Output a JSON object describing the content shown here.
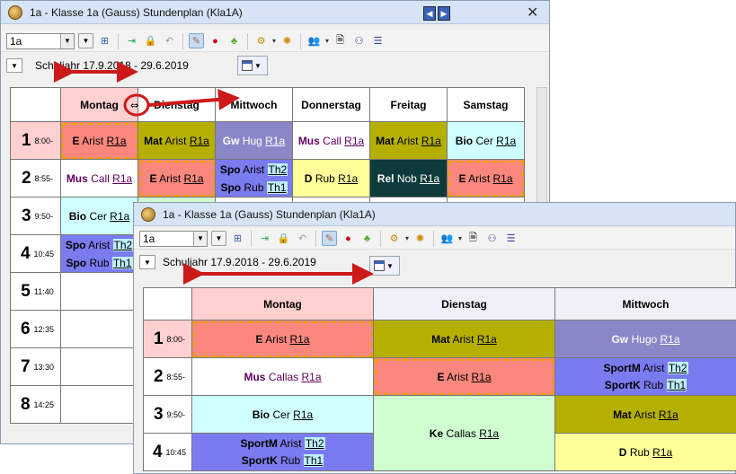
{
  "win1": {
    "title": "1a - Klasse 1a (Gauss)  Stundenplan  (Kla1A)",
    "class_select": "1a",
    "year": "Schuljahr 17.9.2018 - 29.6.2019",
    "days": [
      "Montag",
      "Dienstag",
      "Mittwoch",
      "Donnerstag",
      "Freitag",
      "Samstag"
    ],
    "periods": [
      {
        "num": "1",
        "time": "8:00-"
      },
      {
        "num": "2",
        "time": "8:55-"
      },
      {
        "num": "3",
        "time": "9:50-"
      },
      {
        "num": "4",
        "time": "10:45"
      },
      {
        "num": "5",
        "time": "11:40"
      },
      {
        "num": "6",
        "time": "12:35"
      },
      {
        "num": "7",
        "time": "13:30"
      },
      {
        "num": "8",
        "time": "14:25"
      }
    ],
    "row1": [
      {
        "subj": "E",
        "teacher": "Arist",
        "room": "R1a"
      },
      {
        "subj": "Mat",
        "teacher": "Arist",
        "room": "R1a"
      },
      {
        "subj": "Gw",
        "teacher": "Hug",
        "room": "R1a"
      },
      {
        "subj": "Mus",
        "teacher": "Call",
        "room": "R1a"
      },
      {
        "subj": "Mat",
        "teacher": "Arist",
        "room": "R1a"
      },
      {
        "subj": "Bio",
        "teacher": "Cer",
        "room": "R1a"
      }
    ],
    "row2": [
      {
        "subj": "Mus",
        "teacher": "Call",
        "room": "R1a"
      },
      {
        "subj": "E",
        "teacher": "Arist",
        "room": "R1a"
      },
      {
        "subj": "Spo",
        "teacher": "Arist",
        "room": "Th2",
        "subj2": "Spo",
        "teacher2": "Rub",
        "room2": "Th1"
      },
      {
        "subj": "D",
        "teacher": "Rub",
        "room": "R1a"
      },
      {
        "subj": "Rel",
        "teacher": "Nob",
        "room": "R1a"
      },
      {
        "subj": "E",
        "teacher": "Arist",
        "room": "R1a"
      }
    ],
    "row3_mon": {
      "subj": "Bio",
      "teacher": "Cer",
      "room": "R1a"
    },
    "row4_mon": {
      "subj": "Spo",
      "teacher": "Arist",
      "room": "Th2",
      "subj2": "Spo",
      "teacher2": "Rub",
      "room2": "Th1"
    }
  },
  "win2": {
    "title": "1a - Klasse 1a (Gauss)  Stundenplan  (Kla1A)",
    "class_select": "1a",
    "year": "Schuljahr 17.9.2018 - 29.6.2019",
    "days": [
      "Montag",
      "Dienstag",
      "Mittwoch"
    ],
    "periods": [
      {
        "num": "1",
        "time": "8:00-"
      },
      {
        "num": "2",
        "time": "8:55-"
      },
      {
        "num": "3",
        "time": "9:50-"
      },
      {
        "num": "4",
        "time": "10:45"
      }
    ],
    "cells": {
      "r1": [
        {
          "subj": "E",
          "teacher": "Arist",
          "room": "R1a"
        },
        {
          "subj": "Mat",
          "teacher": "Arist",
          "room": "R1a"
        },
        {
          "subj": "Gw",
          "teacher": "Hugo",
          "room": "R1a"
        }
      ],
      "r2": [
        {
          "subj": "Mus",
          "teacher": "Callas",
          "room": "R1a"
        },
        {
          "subj": "E",
          "teacher": "Arist",
          "room": "R1a"
        },
        {
          "subj": "SportM",
          "teacher": "Arist",
          "room": "Th2",
          "subj2": "SportK",
          "teacher2": "Rub",
          "room2": "Th1"
        }
      ],
      "r3": [
        {
          "subj": "Bio",
          "teacher": "Cer",
          "room": "R1a"
        },
        {
          "subj": "Ke",
          "teacher": "Callas",
          "room": "R1a"
        },
        {
          "subj": "Mat",
          "teacher": "Arist",
          "room": "R1a"
        }
      ],
      "r4": [
        {
          "subj": "SportM",
          "teacher": "Arist",
          "room": "Th2",
          "subj2": "SportK",
          "teacher2": "Rub",
          "room2": "Th1"
        },
        {
          "subj": "D",
          "teacher": "Rub",
          "room": "R1a"
        }
      ]
    }
  },
  "colors": {
    "accent": "#cc1a1a",
    "pink": "#ffd0d0",
    "salmon": "#f9877d",
    "olive": "#b5b000",
    "purple": "#8a87c8",
    "cyan": "#d0ffff",
    "yellow": "#ffff99",
    "darkgreen": "#0d3b3b",
    "blue": "#7b7bf0",
    "lightgreen": "#cfffd0"
  }
}
